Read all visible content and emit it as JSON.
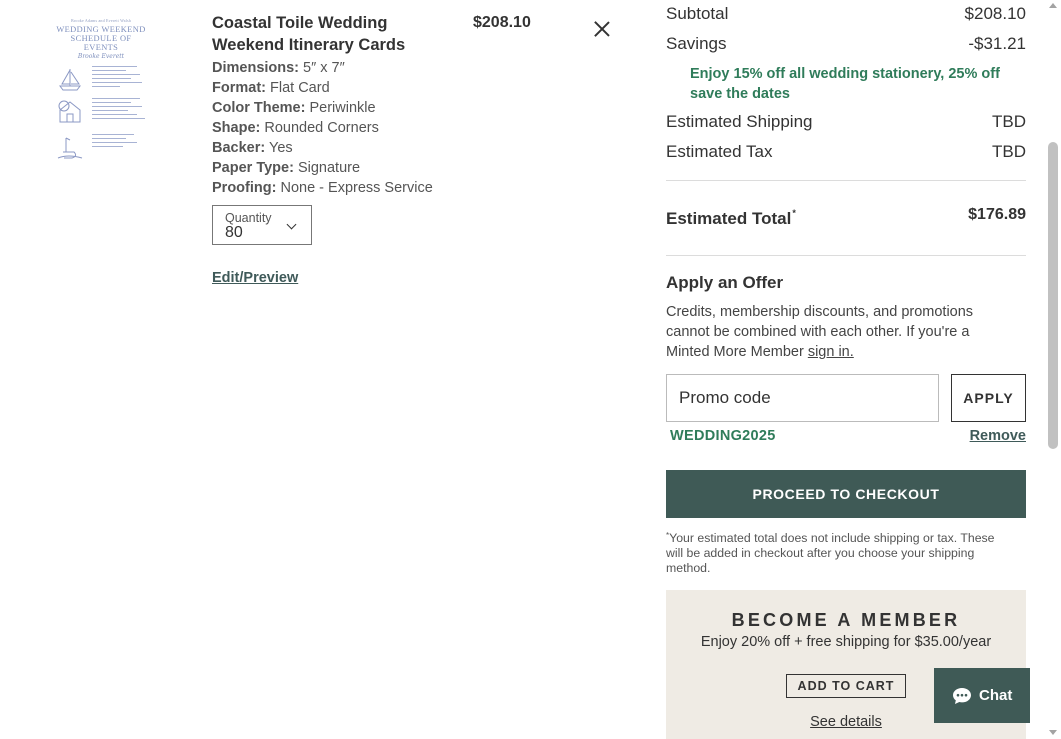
{
  "product": {
    "thumbnail": {
      "kicker": "Brooke Adams and Everett Walsh",
      "title": "WEDDING WEEKEND SCHEDULE OF EVENTS",
      "signature": "Brooke Everett"
    },
    "name": "Coastal Toile Wedding Weekend Itinerary Cards",
    "price": "$208.10",
    "remove_icon": "close-icon",
    "specs": [
      {
        "label": "Dimensions:",
        "value": "5″ x 7″"
      },
      {
        "label": "Format:",
        "value": "Flat Card"
      },
      {
        "label": "Color Theme:",
        "value": "Periwinkle"
      },
      {
        "label": "Shape:",
        "value": "Rounded Corners"
      },
      {
        "label": "Backer:",
        "value": "Yes"
      },
      {
        "label": "Paper Type:",
        "value": "Signature"
      },
      {
        "label": "Proofing:",
        "value": "None - Express Service"
      }
    ],
    "quantity": {
      "label": "Quantity",
      "value": "80"
    },
    "edit_link": "Edit/Preview"
  },
  "summary": {
    "subtotal_label": "Subtotal",
    "subtotal_value": "$208.10",
    "savings_label": "Savings",
    "savings_value": "-$31.21",
    "promo_note": "Enjoy 15% off all wedding stationery, 25% off save the dates",
    "shipping_label": "Estimated Shipping",
    "shipping_value": "TBD",
    "tax_label": "Estimated Tax",
    "tax_value": "TBD",
    "total_label": "Estimated Total",
    "total_marker": "*",
    "total_value": "$176.89"
  },
  "offer": {
    "title": "Apply an Offer",
    "text": "Credits, membership discounts, and promotions cannot be combined with each other. If you're a Minted More Member",
    "sign_in": "sign in.",
    "input_placeholder": "Promo code",
    "apply_label": "APPLY",
    "applied_code": "WEDDING2025",
    "remove_label": "Remove"
  },
  "checkout": {
    "button_label": "PROCEED TO CHECKOUT",
    "disclaimer_marker": "*",
    "disclaimer": "Your estimated total does not include shipping or tax. These will be added in checkout after you choose your shipping method."
  },
  "member": {
    "title": "BECOME A MEMBER",
    "subtitle": "Enjoy 20% off + free shipping for $35.00/year",
    "add_label": "ADD TO CART",
    "details_label": "See details"
  },
  "chat": {
    "label": "Chat",
    "icon": "chat-bubble-icon"
  },
  "colors": {
    "accent": "#3f5a56",
    "promo_green": "#2f7c5a",
    "member_bg": "#efebe4",
    "thumbnail_ink": "#7e8fbd"
  }
}
